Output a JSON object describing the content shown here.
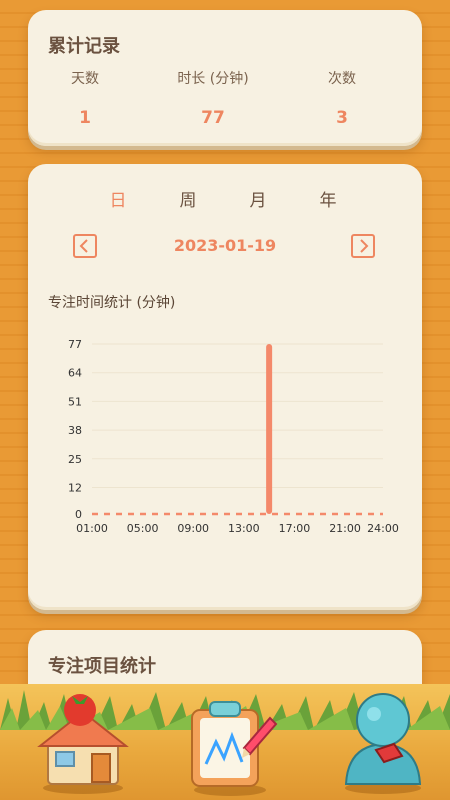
{
  "summary": {
    "title": "累计记录",
    "stats": [
      {
        "label": "天数",
        "value": "1"
      },
      {
        "label": "时长 (分钟)",
        "value": "77"
      },
      {
        "label": "次数",
        "value": "3"
      }
    ]
  },
  "chart_section": {
    "tabs": [
      "日",
      "周",
      "月",
      "年"
    ],
    "active_tab": "日",
    "date": "2023-01-19",
    "chart_title": "专注时间统计 (分钟)"
  },
  "chart_data": {
    "type": "bar",
    "x_ticks": [
      "01:00",
      "05:00",
      "09:00",
      "13:00",
      "17:00",
      "21:00",
      "24:00"
    ],
    "y_ticks": [
      "77",
      "64",
      "51",
      "38",
      "25",
      "12",
      "0"
    ],
    "ylim": [
      0,
      77
    ],
    "bars": [
      {
        "x": "15:00",
        "value": 77
      }
    ],
    "bar_color": "#f4896a",
    "grid": true
  },
  "projects": {
    "title": "专注项目统计"
  },
  "bottom_nav": {
    "items": [
      {
        "name": "home",
        "icon": "house-tomato-icon"
      },
      {
        "name": "stats",
        "icon": "clipboard-chart-icon"
      },
      {
        "name": "profile",
        "icon": "user-avatar-icon"
      }
    ]
  }
}
